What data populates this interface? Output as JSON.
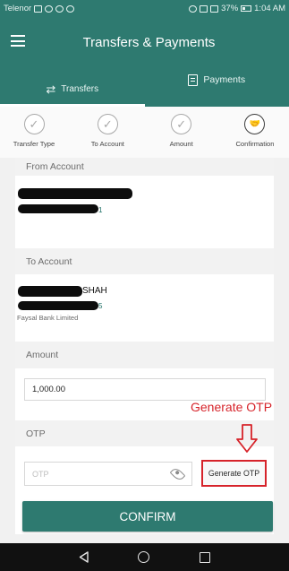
{
  "status_bar": {
    "carrier": "Telenor",
    "battery": "37%",
    "time": "1:04 AM"
  },
  "app_bar": {
    "title": "Transfers & Payments"
  },
  "tabs": [
    {
      "label": "Transfers",
      "icon": "transfer-arrows-icon",
      "active": true
    },
    {
      "label": "Payments",
      "icon": "document-icon",
      "active": false
    }
  ],
  "steps": [
    {
      "label": "Transfer Type",
      "state": "done"
    },
    {
      "label": "To Account",
      "state": "done"
    },
    {
      "label": "Amount",
      "state": "done"
    },
    {
      "label": "Confirmation",
      "state": "current"
    }
  ],
  "from_account": {
    "header": "From Account",
    "number_suffix": "1"
  },
  "to_account": {
    "header": "To Account",
    "name_suffix": "SHAH",
    "number_suffix": "5",
    "bank": "Faysal Bank Limited"
  },
  "amount": {
    "header": "Amount",
    "value": "1,000.00"
  },
  "otp": {
    "header": "OTP",
    "placeholder": "OTP",
    "generate_label": "Generate OTP"
  },
  "annotation": {
    "text": "Generate OTP",
    "color": "#d6232a"
  },
  "confirm_label": "CONFIRM",
  "colors": {
    "primary": "#2e7a70",
    "highlight": "#d6232a",
    "navbar": "#111111"
  }
}
